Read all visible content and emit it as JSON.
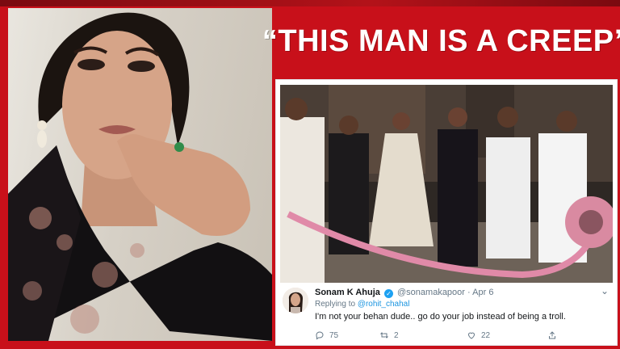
{
  "headline": "“THIS MAN IS A CREEP”",
  "colors": {
    "background": "#c8101a",
    "headline_text": "#ffffff",
    "link": "#1b95e0",
    "verified": "#1da1f2"
  },
  "tweet": {
    "author_name": "Sonam K Ahuja",
    "verified": true,
    "author_handle": "@sonamakapoor",
    "separator": "·",
    "date": "Apr 6",
    "replying_to_label": "Replying to",
    "replying_to_handle": "@rohit_chahal",
    "text": "I'm not your behan dude.. go do your job instead of being a troll.",
    "actions": {
      "replies": "75",
      "retweets": "2",
      "likes": "22"
    },
    "icons": [
      "reply-icon",
      "retweet-icon",
      "like-icon",
      "share-icon",
      "chevron-down-icon",
      "verified-icon"
    ]
  }
}
